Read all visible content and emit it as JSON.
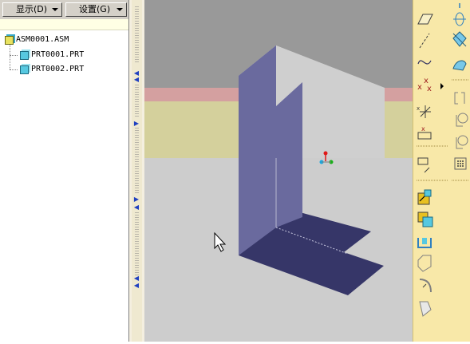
{
  "model_tree": {
    "toolbar": {
      "show_label": "显示(D)",
      "settings_label": "设置(G)"
    },
    "nodes": [
      {
        "label": "ASM0001.ASM",
        "type": "assembly",
        "icon": "assembly-icon"
      },
      {
        "label": "PRT0001.PRT",
        "type": "part",
        "icon": "part-icon"
      },
      {
        "label": "PRT0002.PRT",
        "type": "part",
        "icon": "part-icon"
      }
    ]
  },
  "viewport": {
    "background_color": "#cdcdcd",
    "top_band_color": "#999999",
    "pink_band_color": "#d4a0a0",
    "khaki_band_color": "#d4d09c",
    "vertical_plate_color": "#6a6a9e",
    "horizontal_plate_color": "#363668",
    "cursor": "arrow-cursor",
    "csys": "coordinate-system-icon"
  },
  "right_toolbar": {
    "background_color": "#f8e8a8",
    "tools": [
      "datum-plane-icon",
      "datum-axis-icon",
      "datum-curve-icon",
      "datum-point-icon",
      "datum-point-flyout-icon",
      "sketched-point-icon",
      "offset-point-icon",
      "coordinate-system-icon",
      "assemble-component-icon",
      "create-component-icon",
      "hole-icon",
      "shell-icon",
      "rib-icon",
      "draft-icon",
      "round-icon",
      "chamfer-icon",
      "mirror-tool-icon",
      "extrude-icon",
      "revolve-icon",
      "variable-section-sweep-icon",
      "boundary-blend-icon",
      "pattern-icon"
    ]
  }
}
